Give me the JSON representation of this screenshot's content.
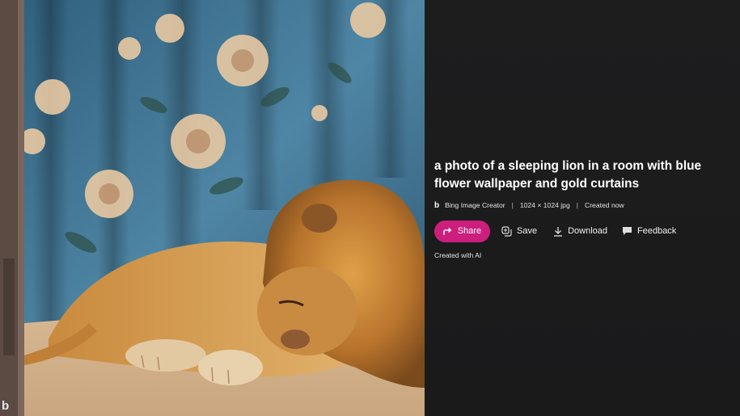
{
  "image": {
    "description_icon": "bing-logo-icon"
  },
  "details": {
    "title": "a photo of a sleeping lion in a room with blue flower wallpaper and gold curtains",
    "source": "Bing Image Creator",
    "dimensions": "1024 × 1024 jpg",
    "created": "Created now",
    "separator": "|",
    "footer": "Created with AI"
  },
  "actions": {
    "share_label": "Share",
    "save_label": "Save",
    "download_label": "Download",
    "feedback_label": "Feedback"
  },
  "colors": {
    "accent": "#cc1f7d",
    "panel_bg": "#1b1b1c"
  }
}
